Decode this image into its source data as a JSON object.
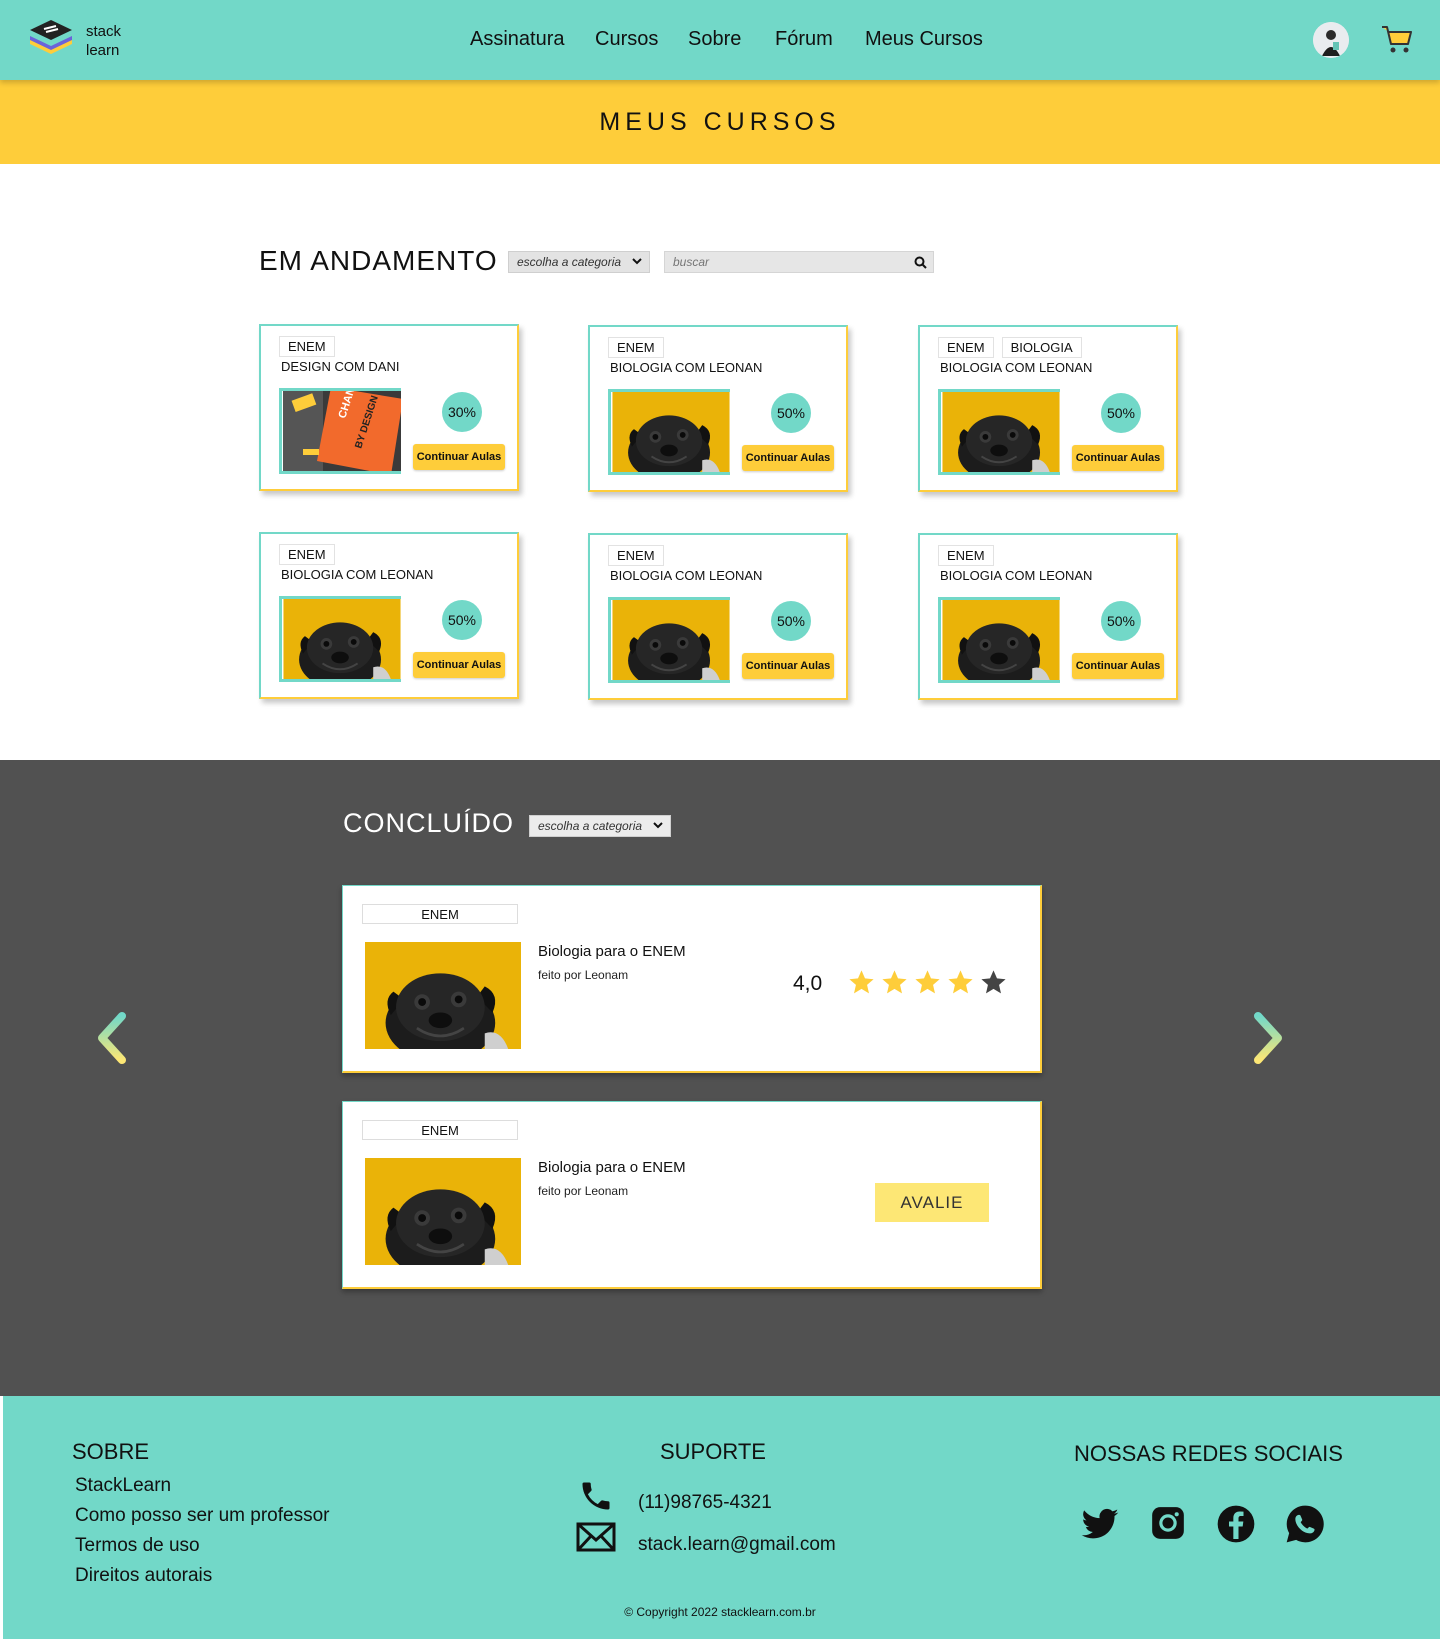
{
  "brand": {
    "line1": "stack",
    "line2": "learn"
  },
  "nav": {
    "items": [
      "Assinatura",
      "Cursos",
      "Sobre",
      "Fórum",
      "Meus Cursos"
    ]
  },
  "page_title": "MEUS CURSOS",
  "in_progress": {
    "title": "EM  ANDAMENTO",
    "category_select": "escolha a categoria",
    "search_placeholder": "buscar",
    "cards": [
      {
        "tags": [
          "ENEM"
        ],
        "title": "DESIGN COM DANI",
        "progress": "30%",
        "button": "Continuar Aulas",
        "image": "change-by-design-book"
      },
      {
        "tags": [
          "ENEM"
        ],
        "title": "BIOLOGIA COM LEONAN",
        "progress": "50%",
        "button": "Continuar Aulas",
        "image": "pug-photo"
      },
      {
        "tags": [
          "ENEM",
          "BIOLOGIA"
        ],
        "title": "BIOLOGIA COM LEONAN",
        "progress": "50%",
        "button": "Continuar Aulas",
        "image": "pug-photo"
      },
      {
        "tags": [
          "ENEM"
        ],
        "title": "BIOLOGIA COM LEONAN",
        "progress": "50%",
        "button": "Continuar Aulas",
        "image": "pug-photo"
      },
      {
        "tags": [
          "ENEM"
        ],
        "title": "BIOLOGIA COM LEONAN",
        "progress": "50%",
        "button": "Continuar Aulas",
        "image": "pug-photo"
      },
      {
        "tags": [
          "ENEM"
        ],
        "title": "BIOLOGIA COM LEONAN",
        "progress": "50%",
        "button": "Continuar Aulas",
        "image": "pug-photo"
      }
    ]
  },
  "completed": {
    "title": "CONCLUÍDO",
    "category_select": "escolha a categoria",
    "courses": [
      {
        "tag": "ENEM",
        "name": "Biologia para o ENEM",
        "author": "feito por Leonam",
        "rating": "4,0",
        "stars_filled": 4,
        "stars_total": 5
      },
      {
        "tag": "ENEM",
        "name": "Biologia para o ENEM",
        "author": "feito por Leonam",
        "action": "AVALIE"
      }
    ]
  },
  "footer": {
    "sobre": {
      "title": "SOBRE",
      "links": [
        "StackLearn",
        "Como posso ser um professor",
        "Termos de uso",
        "Direitos autorais"
      ]
    },
    "suporte": {
      "title": "SUPORTE",
      "phone": "(11)98765-4321",
      "email": "stack.learn@gmail.com"
    },
    "social": {
      "title": "NOSSAS REDES SOCIAIS",
      "icons": [
        "twitter-icon",
        "instagram-icon",
        "facebook-icon",
        "whatsapp-icon"
      ]
    },
    "copyright": "© Copyright 2022 stacklearn.com.br"
  },
  "colors": {
    "teal": "#72d8c8",
    "yellow": "#fecd3a",
    "dark": "#515151",
    "light_yellow": "#fde775"
  }
}
